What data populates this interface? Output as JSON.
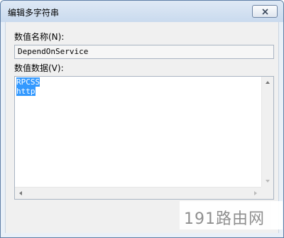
{
  "window": {
    "title": "编辑多字符串"
  },
  "value_name": {
    "label": "数值名称(N):",
    "value": "DependOnService"
  },
  "value_data": {
    "label": "数值数据(V):",
    "lines": [
      "RPCSS",
      "http"
    ]
  },
  "watermark": {
    "text": "191路由网"
  },
  "colors": {
    "selection": "#3399ff",
    "titlebar": "#c9daee",
    "content_bg": "#f0f0f0"
  },
  "icons": {
    "close": "close-icon"
  }
}
